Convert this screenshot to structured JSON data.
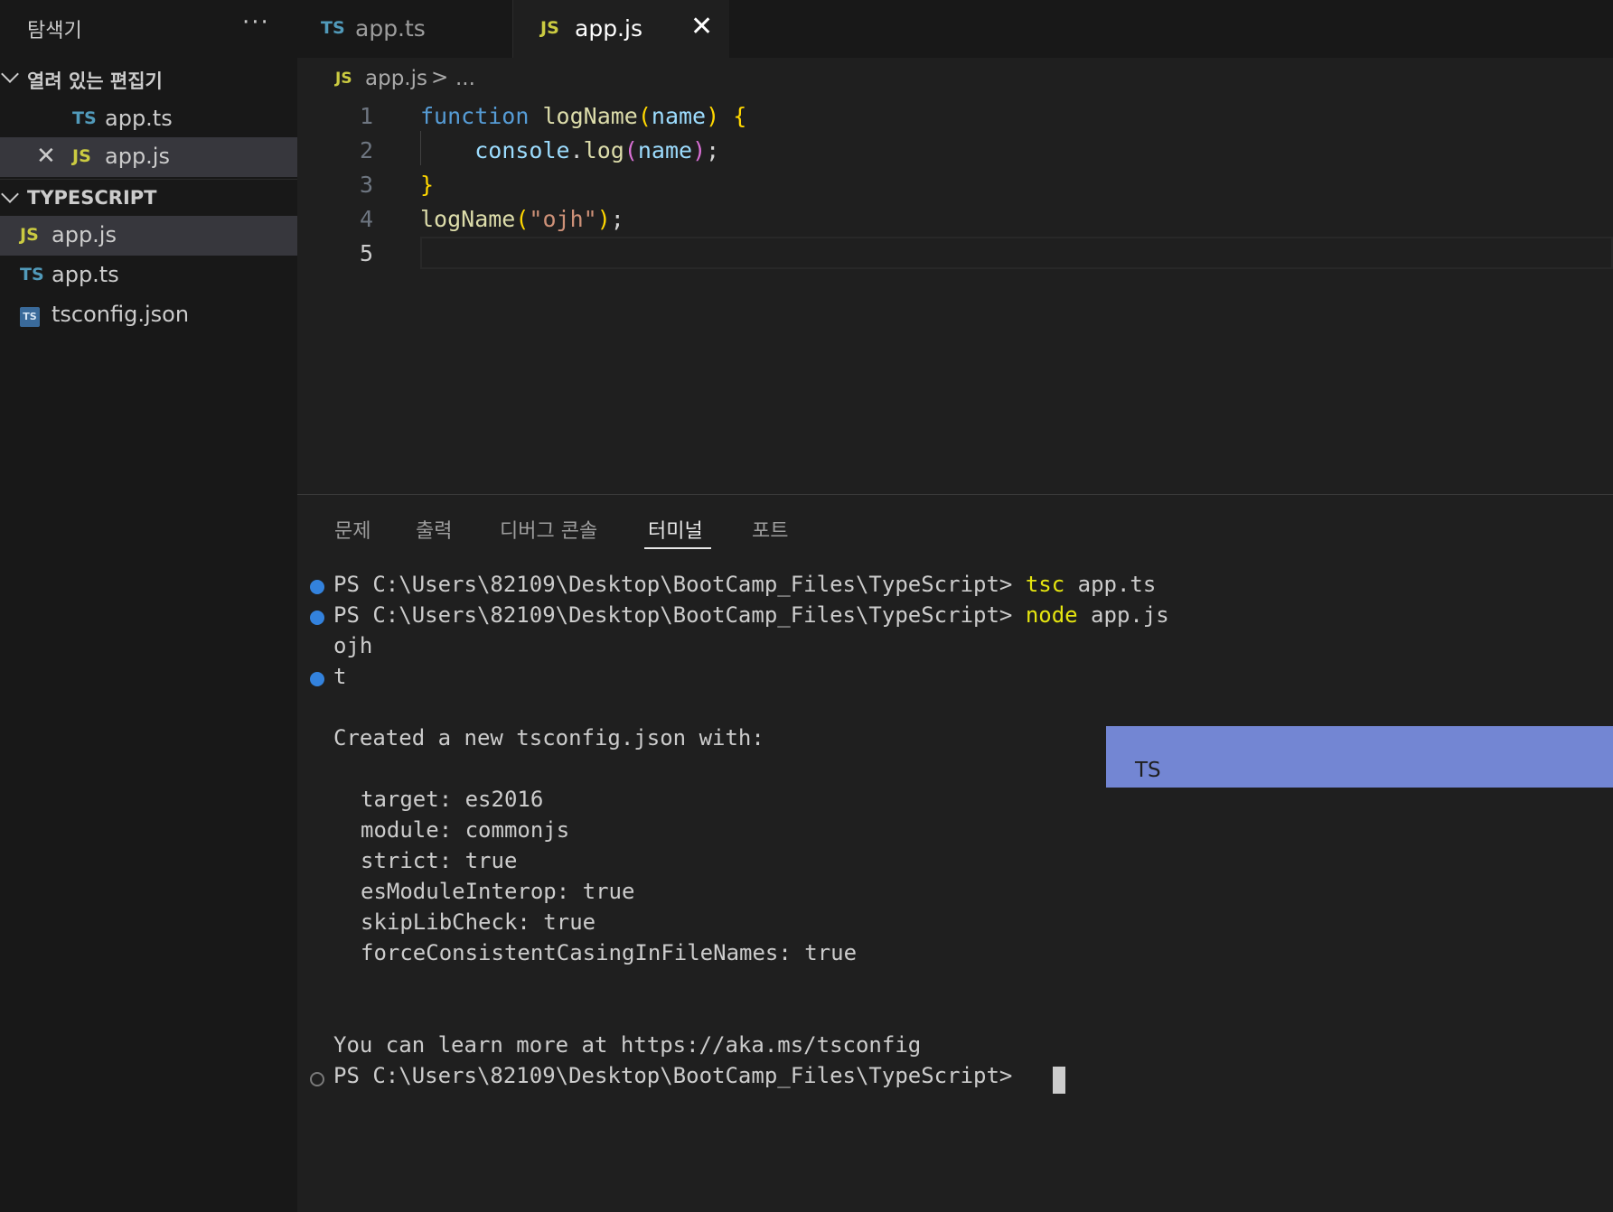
{
  "explorer": {
    "title": "탐색기",
    "more": "···",
    "open_editors": {
      "header": "열려 있는 편집기",
      "items": [
        {
          "badge": "TS",
          "name": "app.ts"
        },
        {
          "badge": "JS",
          "name": "app.js",
          "close": "✕"
        }
      ]
    },
    "folder": {
      "header": "TYPESCRIPT",
      "items": [
        {
          "badge": "JS",
          "name": "app.js"
        },
        {
          "badge": "TS",
          "name": "app.ts"
        },
        {
          "badge": "TS",
          "name": "tsconfig.json"
        }
      ]
    }
  },
  "tabs": [
    {
      "badge": "TS",
      "name": "app.ts"
    },
    {
      "badge": "JS",
      "name": "app.js",
      "close": "✕"
    }
  ],
  "breadcrumb": {
    "badge": "JS",
    "file": "app.js",
    "sep": ">",
    "rest": "..."
  },
  "editor": {
    "line_numbers": [
      "1",
      "2",
      "3",
      "4",
      "5"
    ],
    "lines": {
      "l1": {
        "kw": "function",
        "fn": "logName",
        "open": "(",
        "param": "name",
        "close": ")",
        "brace": "{"
      },
      "l2": {
        "obj": "console",
        "dot": ".",
        "fn": "log",
        "open": "(",
        "param": "name",
        "close": ")",
        "semi": ";"
      },
      "l3": {
        "brace": "}"
      },
      "l4": {
        "fn": "logName",
        "open": "(",
        "str": "\"ojh\"",
        "close": ")",
        "semi": ";"
      }
    }
  },
  "panel": {
    "tabs": [
      "문제",
      "출력",
      "디버그 콘솔",
      "터미널",
      "포트"
    ],
    "terminal": {
      "prompt": "PS C:\\Users\\82109\\Desktop\\BootCamp_Files\\TypeScript>",
      "line1_cmd": "tsc",
      "line1_arg": " app.ts",
      "line2_cmd": "node",
      "line2_arg": " app.js",
      "out1": "ojh",
      "out2": "t",
      "created": "Created a new tsconfig.json with:",
      "options": [
        "target: es2016",
        "module: commonjs",
        "strict: true",
        "esModuleInterop: true",
        "skipLibCheck: true",
        "forceConsistentCasingInFileNames: true"
      ],
      "learn": "You can learn more at https://aka.ms/tsconfig"
    },
    "overlay_label": "TS"
  },
  "colors": {
    "accent_blue": "#3794ff",
    "overlay": "#7386d3",
    "js_badge": "#cbcb41",
    "ts_badge": "#519aba"
  }
}
